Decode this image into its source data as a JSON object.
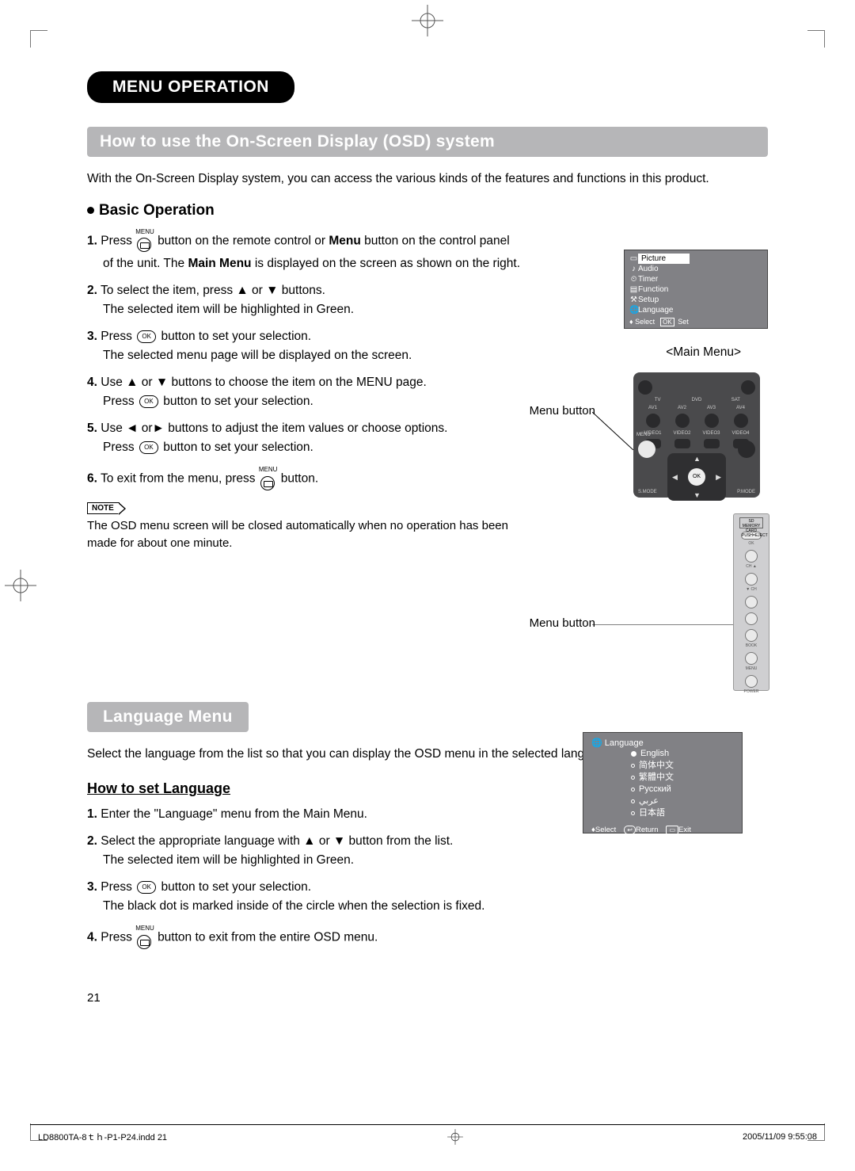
{
  "header": {
    "pill": "MENU OPERATION"
  },
  "section1": {
    "bar": "How to use the On-Screen Display (OSD) system",
    "intro": "With the On-Screen Display system, you can access the various kinds of the features and functions in this product.",
    "sub": "Basic Operation",
    "steps": {
      "s1a": "Press",
      "s1b": "button on the remote control or",
      "s1c": "Menu",
      "s1d": "button on the control panel",
      "s1e": "of the unit. The",
      "s1f": "Main Menu",
      "s1g": "is displayed on the screen as shown on the right.",
      "s2a": "To select the item, press ▲ or ▼ buttons.",
      "s2b": "The selected item will be highlighted in Green.",
      "s3a": "Press",
      "s3b": "button to set your selection.",
      "s3c": "The selected menu page will be displayed on the screen.",
      "s4a": "Use ▲ or ▼ buttons to choose the item on the MENU page.",
      "s4b": "Press",
      "s4c": "button to set your selection.",
      "s5a": "Use ◄ or► buttons to adjust the item values or choose options.",
      "s5b": "Press",
      "s5c": "button to set your selection.",
      "s6a": "To exit from the menu, press",
      "s6b": "button."
    },
    "note_label": "NOTE",
    "note": "The OSD menu screen will be closed automatically when no operation has been made for about one minute.",
    "menu_tiny": "MENU",
    "ok_tiny": "OK"
  },
  "osd_main": {
    "items": [
      "Picture",
      "Audio",
      "Timer",
      "Function",
      "Setup",
      "Language"
    ],
    "hint_select": "Select",
    "hint_ok": "OK",
    "hint_set": "Set",
    "caption": "<Main Menu>"
  },
  "remote": {
    "label": "Menu button",
    "row1": [
      "TV",
      "DVD",
      "SAT"
    ],
    "row2": [
      "AV1",
      "AV2",
      "AV3",
      "AV4"
    ],
    "row3": [
      "VIDEO1",
      "VIDEO2",
      "VIDEO3",
      "VIDEO4"
    ],
    "menu": "MENU",
    "ok": "OK",
    "smode": "S.MODE",
    "pmode": "P.MODE"
  },
  "panel": {
    "label": "Menu button",
    "sd": "SD MEMORY CARD",
    "eject": "PUSH=EJECT",
    "ok": "OK",
    "ch_up": "CH ▲",
    "ch_dn": "▼ CH",
    "vol_up": "▶",
    "vol_dn": "◀",
    "book": "BOOK",
    "menu": "MENU",
    "power": "POWER"
  },
  "section2": {
    "bar": "Language Menu",
    "intro": "Select the language from the list so that you can display the OSD menu in the selected language.",
    "sub": "How to set Language",
    "steps": {
      "s1": "Enter the \"Language\" menu from the Main Menu.",
      "s2a": "Select the appropriate language with ▲ or ▼ button from the list.",
      "s2b": "The selected item will be highlighted in Green.",
      "s3a": "Press",
      "s3b": "button to set your selection.",
      "s3c": "The black dot is marked inside of the circle when the selection is fixed.",
      "s4a": "Press",
      "s4b": "button to exit from the entire OSD menu."
    }
  },
  "osd_lang": {
    "title": "Language",
    "options": [
      "English",
      "简体中文",
      "繁體中文",
      "Русский",
      "عربي",
      "日本語"
    ],
    "hint_select": "Select",
    "hint_return": "Return",
    "hint_exit": "Exit"
  },
  "page_number": "21",
  "footer": {
    "file": "LD8800TA-8ｔｈ-P1-P24.indd   21",
    "date": "2005/11/09   9:55:08"
  }
}
